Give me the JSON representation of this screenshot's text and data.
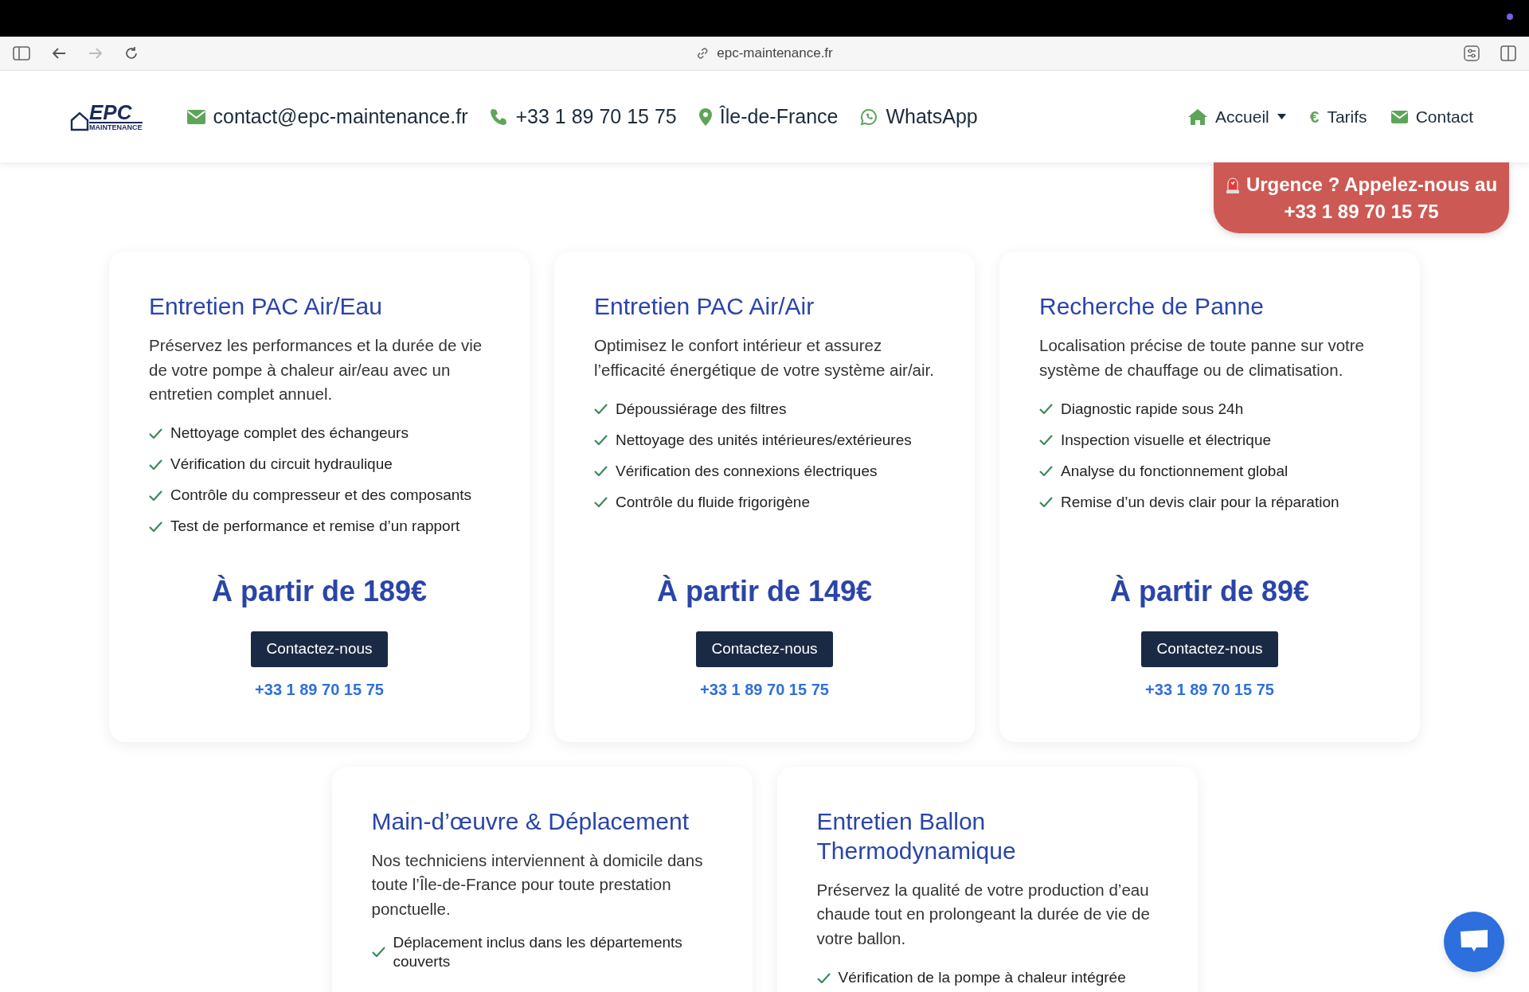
{
  "browser": {
    "url": "epc-maintenance.fr"
  },
  "header": {
    "logo": {
      "name": "EPC",
      "tagline": "MAINTENANCE"
    },
    "contacts": [
      {
        "kind": "mail",
        "text": "contact@epc-maintenance.fr"
      },
      {
        "kind": "phone",
        "text": "+33 1 89 70 15 75"
      },
      {
        "kind": "pin",
        "text": "Île-de-France"
      },
      {
        "kind": "whatsapp",
        "text": "WhatsApp"
      }
    ],
    "nav": [
      {
        "kind": "home",
        "label": "Accueil",
        "dropdown": true
      },
      {
        "kind": "euro",
        "glyph": "€",
        "label": "Tarifs",
        "dropdown": false
      },
      {
        "kind": "mail",
        "label": "Contact",
        "dropdown": false
      }
    ]
  },
  "urgent_banner": {
    "line1": "Urgence ? Appelez-nous au",
    "line2": "+33 1 89 70 15 75"
  },
  "cards": [
    {
      "title": "Entretien PAC Air/Eau",
      "description": "Préservez les performances et la durée de vie de votre pompe à chaleur air/eau avec un entretien complet annuel.",
      "features": [
        "Nettoyage complet des échangeurs",
        "Vérification du circuit hydraulique",
        "Contrôle du compresseur et des composants",
        "Test de performance et remise d’un rapport"
      ],
      "price": "À partir de 189€",
      "button": "Contactez-nous",
      "phone": "+33 1 89 70 15 75"
    },
    {
      "title": "Entretien PAC Air/Air",
      "description": "Optimisez le confort intérieur et assurez l’efficacité énergétique de votre système air/air.",
      "features": [
        "Dépoussiérage des filtres",
        "Nettoyage des unités intérieures/extérieures",
        "Vérification des connexions électriques",
        "Contrôle du fluide frigorigène"
      ],
      "price": "À partir de 149€",
      "button": "Contactez-nous",
      "phone": "+33 1 89 70 15 75"
    },
    {
      "title": "Recherche de Panne",
      "description": "Localisation précise de toute panne sur votre système de chauffage ou de climatisation.",
      "features": [
        "Diagnostic rapide sous 24h",
        "Inspection visuelle et électrique",
        "Analyse du fonctionnement global",
        "Remise d’un devis clair pour la réparation"
      ],
      "price": "À partir de 89€",
      "button": "Contactez-nous",
      "phone": "+33 1 89 70 15 75"
    }
  ],
  "cards_row_2": [
    {
      "title": "Main-d’œuvre & Déplacement",
      "description": "Nos techniciens interviennent à domicile dans toute l’Île-de-France pour toute prestation ponctuelle.",
      "features": [
        "Déplacement inclus dans les départements couverts"
      ]
    },
    {
      "title": "Entretien Ballon Thermodynamique",
      "description": "Préservez la qualité de votre production d’eau chaude tout en prolongeant la durée de vie de votre ballon.",
      "features": [
        "Vérification de la pompe à chaleur intégrée"
      ]
    }
  ]
}
